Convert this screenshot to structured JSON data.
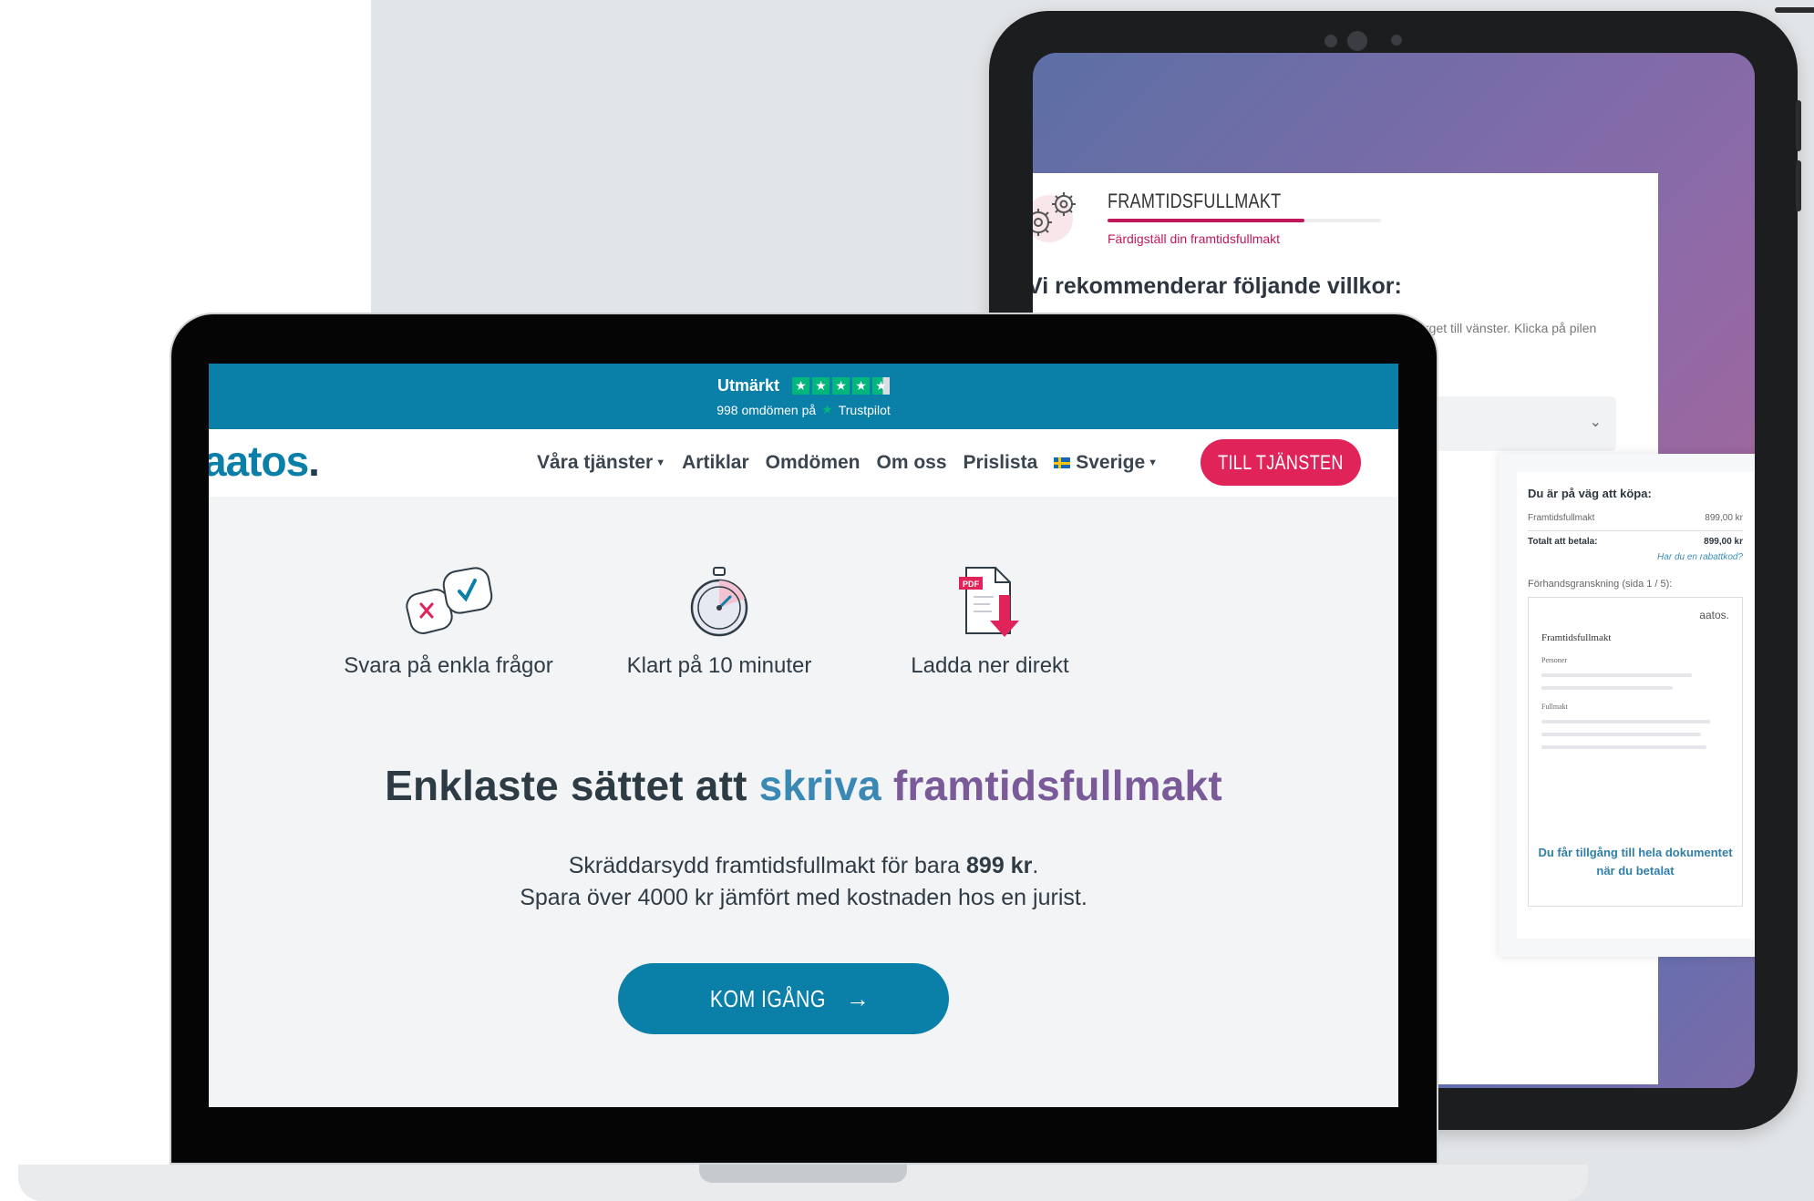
{
  "tablet": {
    "form": {
      "title": "FRAMTIDSFULLMAKT",
      "subtitle": "Färdigställ din framtidsfullmakt",
      "progress": 0.72,
      "heading": "Vi rekommenderar följande villkor:",
      "hint": "rget till vänster. Klicka på pilen"
    },
    "checkout": {
      "title": "Du är på väg att köpa:",
      "item_label": "Framtidsfullmakt",
      "item_price": "899,00 kr",
      "total_label": "Totalt att betala:",
      "total_price": "899,00 kr",
      "discount_link": "Har du en rabattkod?",
      "preview_label": "Förhandsgranskning (sida 1 / 5):",
      "preview_logo": "aatos.",
      "preview_doc_title": "Framtidsfullmakt",
      "preview_section_1": "Personer",
      "preview_section_2": "Fullmakt",
      "lock_message": "Du får tillgång till hela dokumentet när du betalat"
    }
  },
  "laptop": {
    "trustpilot": {
      "rating_word": "Utmärkt",
      "stars": 4.5,
      "reviews_text": "998 omdömen på",
      "brand": "Trustpilot",
      "star_color": "#00b67a"
    },
    "nav": {
      "logo": "aatos",
      "logo_dot": ".",
      "items": [
        {
          "label": "Våra tjänster",
          "dropdown": true
        },
        {
          "label": "Artiklar"
        },
        {
          "label": "Omdömen"
        },
        {
          "label": "Om oss"
        },
        {
          "label": "Prislista"
        }
      ],
      "country": "Sverige",
      "cta": "TILL TJÄNSTEN"
    },
    "features": [
      {
        "icon": "quiz-check-icon",
        "label": "Svara på enkla frågor"
      },
      {
        "icon": "stopwatch-icon",
        "label": "Klart på 10 minuter"
      },
      {
        "icon": "pdf-download-icon",
        "label": "Ladda ner direkt"
      }
    ],
    "hero": {
      "headline_start": "Enklaste sättet att ",
      "headline_blue": "skriva ",
      "headline_purple": "framtidsfullmakt",
      "desc_line1_start": "Skräddarsydd framtidsfullmakt för bara ",
      "desc_price": "899 kr",
      "desc_line1_end": ".",
      "desc_line2": "Spara över 4000 kr jämfört med kostnaden hos en jurist.",
      "cta": "KOM IGÅNG",
      "cta_arrow": "→"
    },
    "colors": {
      "primary": "#0a7fa8",
      "accent": "#e0245a",
      "headline_blue": "#3a89b5",
      "headline_purple": "#7a5a99"
    }
  }
}
